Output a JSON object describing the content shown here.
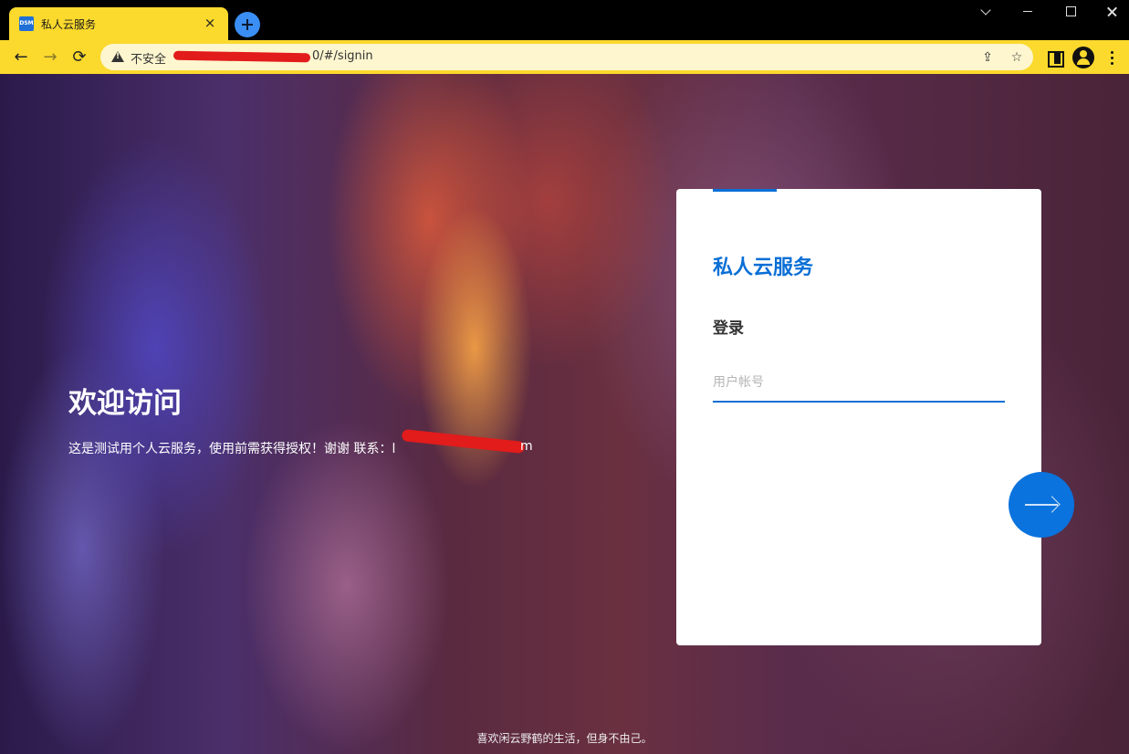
{
  "browser": {
    "tab": {
      "title": "私人云服务",
      "favicon_text": "DSM",
      "close_label": "×"
    },
    "toolbar": {
      "back_label": "←",
      "forward_label": "→",
      "reload_label": "⟳"
    },
    "address_bar": {
      "security_label": "不安全",
      "url_visible": "0/#/signin"
    },
    "icons": {
      "security": "warning-triangle-icon",
      "share": "share-icon",
      "bookmark": "star-icon",
      "side_panel": "side-panel-icon",
      "profile": "profile-icon",
      "menu": "kebab-menu-icon"
    }
  },
  "page": {
    "welcome": {
      "title": "欢迎访问",
      "description": "这是测试用个人云服务，使用前需获得授权！谢谢 联系：l",
      "description_tail": "m"
    },
    "login_card": {
      "title": "私人云服务",
      "subtitle": "登录",
      "username_placeholder": "用户帐号"
    },
    "footer": "喜欢闲云野鹤的生活，但身不由己。"
  },
  "colors": {
    "browser_accent": "#fbd92d",
    "brand_blue": "#0a6fd6",
    "redaction": "#e21b1b"
  }
}
